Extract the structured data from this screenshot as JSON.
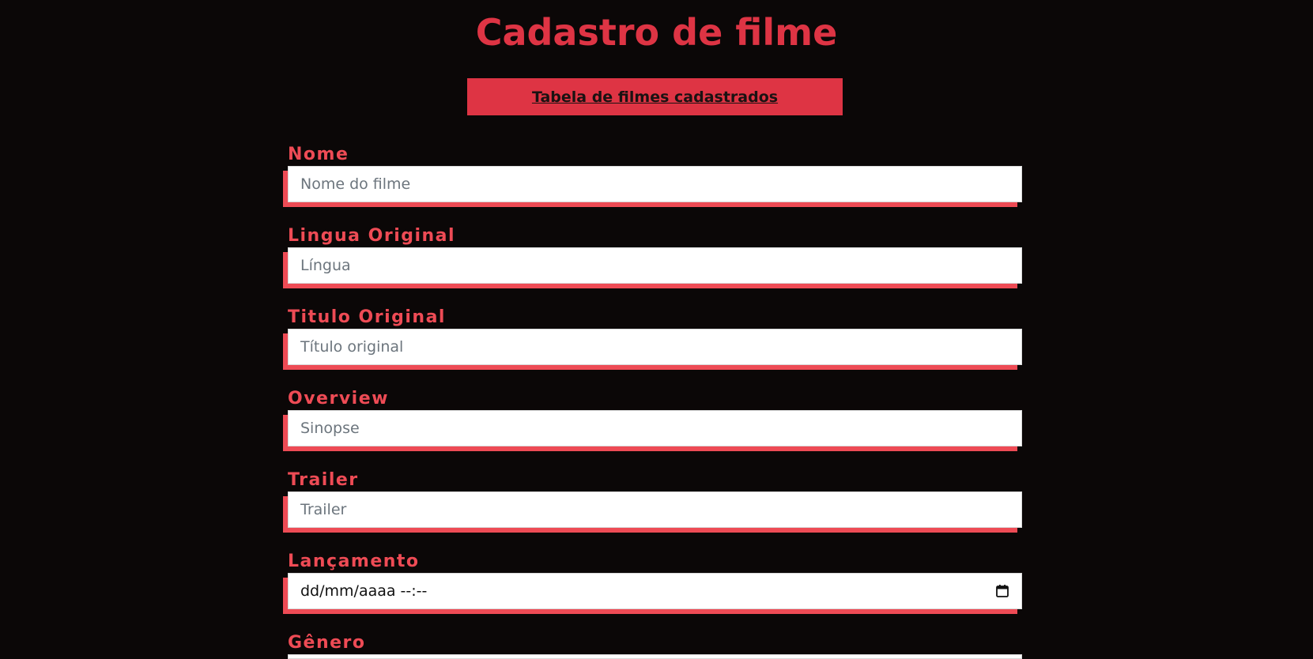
{
  "page": {
    "title": "Cadastro de filme",
    "table_link_label": "Tabela de filmes cadastrados"
  },
  "fields": {
    "nome": {
      "label": "Nome",
      "placeholder": "Nome do filme"
    },
    "lingua": {
      "label": "Lingua Original",
      "placeholder": "Língua"
    },
    "titulo": {
      "label": "Titulo Original",
      "placeholder": "Título original"
    },
    "overview": {
      "label": "Overview",
      "placeholder": "Sinopse"
    },
    "trailer": {
      "label": "Trailer",
      "placeholder": "Trailer"
    },
    "lancamento": {
      "label": "Lançamento",
      "value_display": "dd/mm/aaaa --:--",
      "icon": "calendar-icon"
    },
    "genero": {
      "label": "Gênero"
    }
  },
  "colors": {
    "background": "#0b0707",
    "accent": "#de3444",
    "label": "#ee4b55"
  }
}
